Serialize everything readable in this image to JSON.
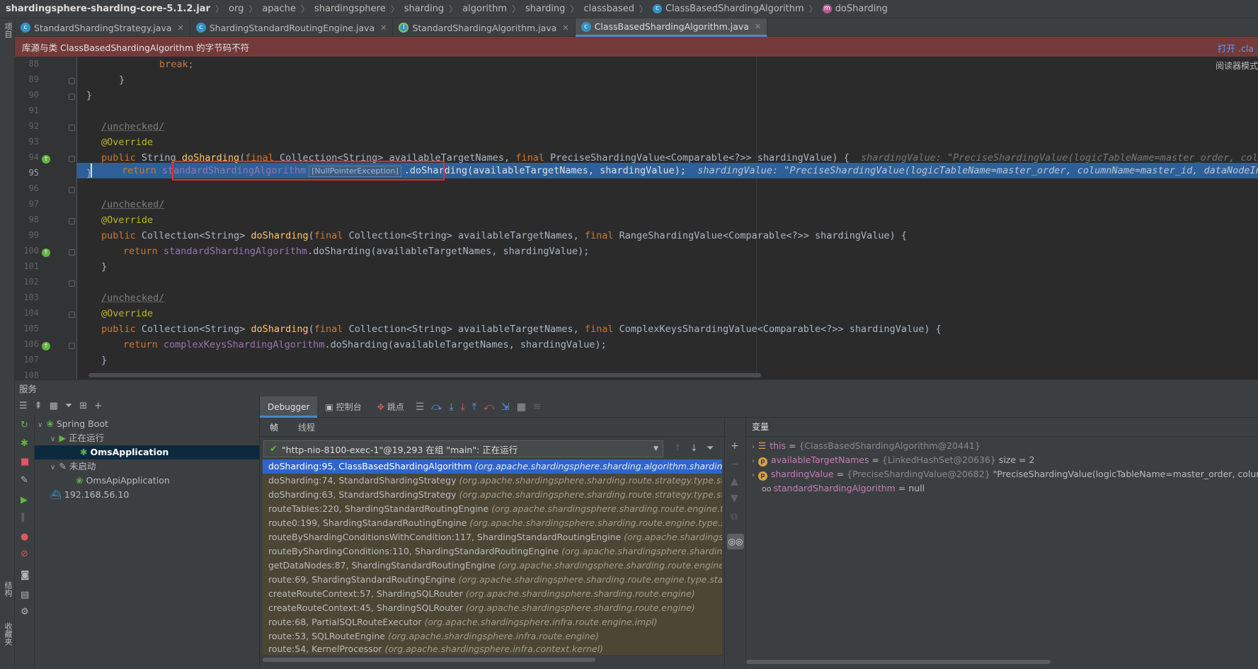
{
  "breadcrumb": {
    "items": [
      "shardingsphere-sharding-core-5.1.2.jar",
      "org",
      "apache",
      "shardingsphere",
      "sharding",
      "algorithm",
      "sharding",
      "classbased",
      "ClassBasedShardingAlgorithm",
      "doSharding"
    ]
  },
  "left_strip": {
    "project": "项目",
    "structure": "结构",
    "favorites": "收藏夹"
  },
  "tabs": [
    {
      "label": "StandardShardingStrategy.java"
    },
    {
      "label": "ShardingStandardRoutingEngine.java"
    },
    {
      "label": "StandardShardingAlgorithm.java"
    },
    {
      "label": "ClassBasedShardingAlgorithm.java"
    }
  ],
  "warning": {
    "text": "库源与类 ClassBasedShardingAlgorithm 的字节码不符",
    "action": "打开 .cla"
  },
  "editor": {
    "reader_mode": "阅读器模式",
    "lines": [
      "88",
      "89",
      "90",
      "91",
      "92",
      "93",
      "94",
      "95",
      "96",
      "97",
      "98",
      "99",
      "100",
      "101",
      "102",
      "103",
      "104",
      "105",
      "106",
      "107",
      "108"
    ],
    "code": {
      "l88_break": "break;",
      "brace": "}",
      "unchecked": "/unchecked/",
      "override": "@Override",
      "kw_public": "public",
      "kw_final": "final",
      "kw_return": "return",
      "t_string": "String",
      "t_coll_string": "Collection<String>",
      "m_do": "doSharding",
      "p_targets": "availableTargetNames,",
      "t_precise": "PreciseShardingValue<Comparable<?>>",
      "t_range": "RangeShardingValue<Comparable<?>>",
      "t_complex": "ComplexKeysShardingValue<Comparable<?>>",
      "p_sharding_open": "shardingValue) {",
      "std_alg": "standardShardingAlgorithm",
      "complex_alg": "complexKeysShardingAlgorithm",
      "call_rest": ".doSharding(availableTargetNames, shardingValue);",
      "npe": "[NullPointerException]",
      "l95_call": ".doSharding",
      "l95_args": "(availableTargetNames, shardingValue);",
      "hint94": "shardingValue: \"PreciseShardingValue(logicTableName=master_order, column",
      "hint95": "shardingValue: \"PreciseShardingValue(logicTableName=master_order, columnName=master_id, dataNodeInfo"
    }
  },
  "services": {
    "title": "服务",
    "tree": {
      "spring_boot": "Spring Boot",
      "running": "正在运行",
      "oms_app": "OmsApplication",
      "not_started": "未启动",
      "oms_api": "OmsApiApplication",
      "docker": "192.168.56.10"
    }
  },
  "debugger": {
    "tabs": [
      "Debugger",
      "控制台",
      "跳点"
    ],
    "subtabs": [
      "帧",
      "线程"
    ],
    "thread": "\"http-nio-8100-exec-1\"@19,293 在组 \"main\": 正在运行",
    "frames": [
      {
        "method": "doSharding:95, ClassBasedShardingAlgorithm",
        "pkg": "(org.apache.shardingsphere.sharding.algorithm.sharding.classba"
      },
      {
        "method": "doSharding:74, StandardShardingStrategy",
        "pkg": "(org.apache.shardingsphere.sharding.route.strategy.type.standard)"
      },
      {
        "method": "doSharding:63, StandardShardingStrategy",
        "pkg": "(org.apache.shardingsphere.sharding.route.strategy.type.standard)"
      },
      {
        "method": "routeTables:220, ShardingStandardRoutingEngine",
        "pkg": "(org.apache.shardingsphere.sharding.route.engine.type.stan"
      },
      {
        "method": "route0:199, ShardingStandardRoutingEngine",
        "pkg": "(org.apache.shardingsphere.sharding.route.engine.type.standard"
      },
      {
        "method": "routeByShardingConditionsWithCondition:117, ShardingStandardRoutingEngine",
        "pkg": "(org.apache.shardingsphere.sh"
      },
      {
        "method": "routeByShardingConditions:110, ShardingStandardRoutingEngine",
        "pkg": "(org.apache.shardingsphere.sharding.route.e"
      },
      {
        "method": "getDataNodes:87, ShardingStandardRoutingEngine",
        "pkg": "(org.apache.shardingsphere.sharding.route.engine.type.sta"
      },
      {
        "method": "route:69, ShardingStandardRoutingEngine",
        "pkg": "(org.apache.shardingsphere.sharding.route.engine.type.standard)"
      },
      {
        "method": "createRouteContext:57, ShardingSQLRouter",
        "pkg": "(org.apache.shardingsphere.sharding.route.engine)"
      },
      {
        "method": "createRouteContext:45, ShardingSQLRouter",
        "pkg": "(org.apache.shardingsphere.sharding.route.engine)"
      },
      {
        "method": "route:68, PartialSQLRouteExecutor",
        "pkg": "(org.apache.shardingsphere.infra.route.engine.impl)"
      },
      {
        "method": "route:53, SQLRouteEngine",
        "pkg": "(org.apache.shardingsphere.infra.route.engine)"
      },
      {
        "method": "route:54, KernelProcessor",
        "pkg": "(org.apache.shardingsphere.infra.context.kernel)"
      }
    ],
    "variables": {
      "title": "变量",
      "rows": [
        {
          "name": "this",
          "eq": " = ",
          "type": "{ClassBasedShardingAlgorithm@20441}",
          "value": ""
        },
        {
          "name": "availableTargetNames",
          "eq": " = ",
          "type": "{LinkedHashSet@20636}",
          "value": "  size = 2"
        },
        {
          "name": "shardingValue",
          "eq": " = ",
          "type": "{PreciseShardingValue@20682}",
          "value": " \"PreciseShardingValue(logicTableName=master_order, columnNam"
        },
        {
          "name": "standardShardingAlgorithm",
          "eq": " = ",
          "type": "",
          "value": "null"
        }
      ]
    }
  }
}
